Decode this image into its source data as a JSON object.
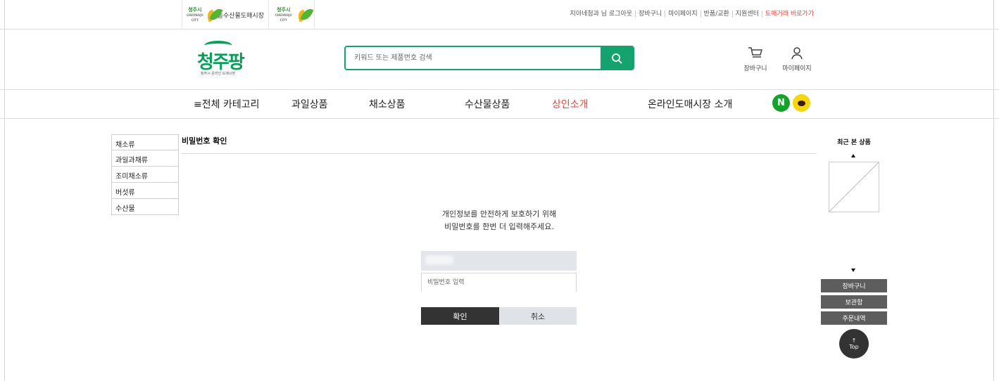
{
  "topbar": {
    "logo1_city": "청주시",
    "logo1_city_en": "CHEONGJU CITY",
    "logo1_text": "농수산물도매시장",
    "logo2_city": "청주시",
    "logo2_city_en": "CHEONGJU CITY",
    "links": [
      "지아네청과 님 로그아웃",
      "장바구니",
      "마이페이지",
      "반품/교환",
      "지원센터",
      "도매거래 바로가기"
    ]
  },
  "header": {
    "brand_word": "청주",
    "brand_mark": "팡",
    "brand_sub": "청주시 온라인 도매시장",
    "search_placeholder": "키워드 또는 제품번호 검색",
    "cart_label": "장바구니",
    "mypage_label": "마이페이지"
  },
  "nav": {
    "items": [
      "≡전체 카테고리",
      "과일상품",
      "채소상품",
      "수산물상품",
      "상인소개",
      "온라인도매시장 소개"
    ],
    "active": "상인소개",
    "naver_label": "N"
  },
  "categories": [
    "채소류",
    "과일과채류",
    "조미채소류",
    "버섯류",
    "수산물"
  ],
  "main": {
    "title": "비밀번호 확인",
    "notice_line1": "개인정보를 안전하게 보호하기 위해",
    "notice_line2": "비밀번호를 한번 더 입력해주세요.",
    "password_placeholder": "비밀번호 입력",
    "confirm_label": "확인",
    "cancel_label": "취소"
  },
  "sidebar_right": {
    "recent_title": "최근 본 상품",
    "cart": "장바구니",
    "storage": "보관함",
    "orders": "주문내역",
    "top_arrow": "↑",
    "top_label": "Top"
  },
  "colors": {
    "brand_green": "#14a26e",
    "active_nav": "#e8463e",
    "highlight_link": "#e0443a"
  }
}
